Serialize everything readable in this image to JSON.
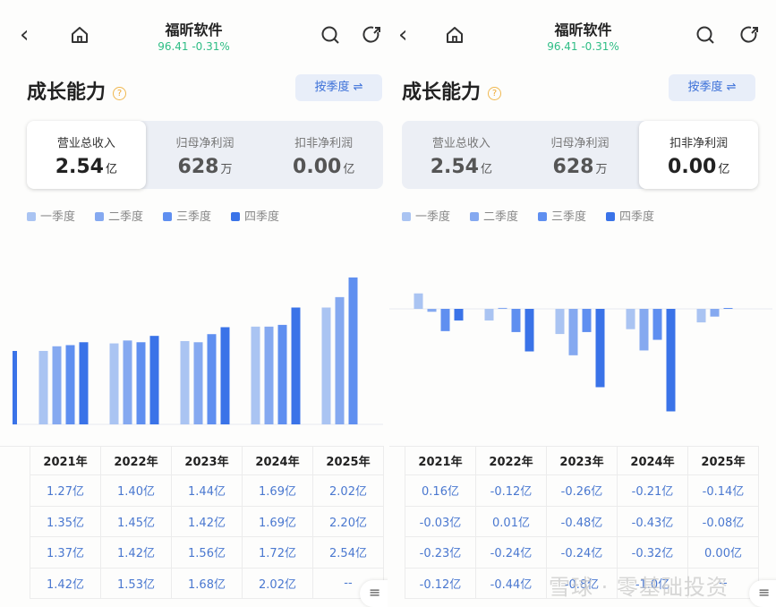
{
  "colors": {
    "q1": "#aac4f2",
    "q2": "#85a9f0",
    "q3": "#5f8ff0",
    "q4": "#3a73e8",
    "quote": "#2ebd85"
  },
  "panels": [
    {
      "nav": {
        "title": "福昕软件",
        "quote": "96.41 -0.31%"
      },
      "section_title": "成长能力",
      "help": "?",
      "period_button": "按季度 ⇌",
      "metrics": [
        {
          "label": "营业总收入",
          "value": "2.54",
          "unit": "亿",
          "active": true
        },
        {
          "label": "归母净利润",
          "value": "628",
          "unit": "万",
          "active": false
        },
        {
          "label": "扣非净利润",
          "value": "0.00",
          "unit": "亿",
          "active": false
        }
      ],
      "legend": [
        "一季度",
        "二季度",
        "三季度",
        "四季度"
      ],
      "table": {
        "headers": [
          "2021年",
          "2022年",
          "2023年",
          "2024年",
          "2025年"
        ],
        "rows": [
          [
            "1.27亿",
            "1.40亿",
            "1.44亿",
            "1.69亿",
            "2.02亿"
          ],
          [
            "1.35亿",
            "1.45亿",
            "1.42亿",
            "1.69亿",
            "2.20亿"
          ],
          [
            "1.37亿",
            "1.42亿",
            "1.56亿",
            "1.72亿",
            "2.54亿"
          ],
          [
            "1.42亿",
            "1.53亿",
            "1.68亿",
            "2.02亿",
            "--"
          ]
        ]
      }
    },
    {
      "nav": {
        "title": "福昕软件",
        "quote": "96.41 -0.31%"
      },
      "section_title": "成长能力",
      "help": "?",
      "period_button": "按季度 ⇌",
      "metrics": [
        {
          "label": "营业总收入",
          "value": "2.54",
          "unit": "亿",
          "active": false
        },
        {
          "label": "归母净利润",
          "value": "628",
          "unit": "万",
          "active": false
        },
        {
          "label": "扣非净利润",
          "value": "0.00",
          "unit": "亿",
          "active": true
        }
      ],
      "legend": [
        "一季度",
        "二季度",
        "三季度",
        "四季度"
      ],
      "table": {
        "headers": [
          "2021年",
          "2022年",
          "2023年",
          "2024年",
          "2025年"
        ],
        "rows": [
          [
            "0.16亿",
            "-0.12亿",
            "-0.26亿",
            "-0.21亿",
            "-0.14亿"
          ],
          [
            "-0.03亿",
            "0.01亿",
            "-0.48亿",
            "-0.43亿",
            "-0.08亿"
          ],
          [
            "-0.23亿",
            "-0.24亿",
            "-0.24亿",
            "-0.32亿",
            "0.00亿"
          ],
          [
            "-0.12亿",
            "-0.44亿",
            "-0.8亿",
            "-1.0亿",
            "--"
          ]
        ]
      }
    }
  ],
  "chart_data": [
    {
      "type": "bar",
      "categories": [
        "2021年",
        "2022年",
        "2023年",
        "2024年",
        "2025年"
      ],
      "unit": "亿",
      "series": [
        {
          "name": "一季度",
          "values": [
            1.27,
            1.4,
            1.44,
            1.69,
            2.02
          ]
        },
        {
          "name": "二季度",
          "values": [
            1.35,
            1.45,
            1.42,
            1.69,
            2.2
          ]
        },
        {
          "name": "三季度",
          "values": [
            1.37,
            1.42,
            1.56,
            1.72,
            2.54
          ]
        },
        {
          "name": "四季度",
          "values": [
            1.42,
            1.53,
            1.68,
            2.02,
            null
          ]
        }
      ],
      "grid": false,
      "legend": "top-left"
    },
    {
      "type": "bar",
      "categories": [
        "2021年",
        "2022年",
        "2023年",
        "2024年",
        "2025年"
      ],
      "unit": "亿",
      "series": [
        {
          "name": "一季度",
          "values": [
            0.16,
            -0.12,
            -0.26,
            -0.21,
            -0.14
          ]
        },
        {
          "name": "二季度",
          "values": [
            -0.03,
            0.01,
            -0.48,
            -0.43,
            -0.08
          ]
        },
        {
          "name": "三季度",
          "values": [
            -0.23,
            -0.24,
            -0.24,
            -0.32,
            0.0
          ]
        },
        {
          "name": "四季度",
          "values": [
            -0.12,
            -0.44,
            -0.81,
            -1.06,
            null
          ]
        }
      ],
      "grid": false,
      "legend": "top-left"
    }
  ],
  "watermark": "雪球 · 零基础投资"
}
